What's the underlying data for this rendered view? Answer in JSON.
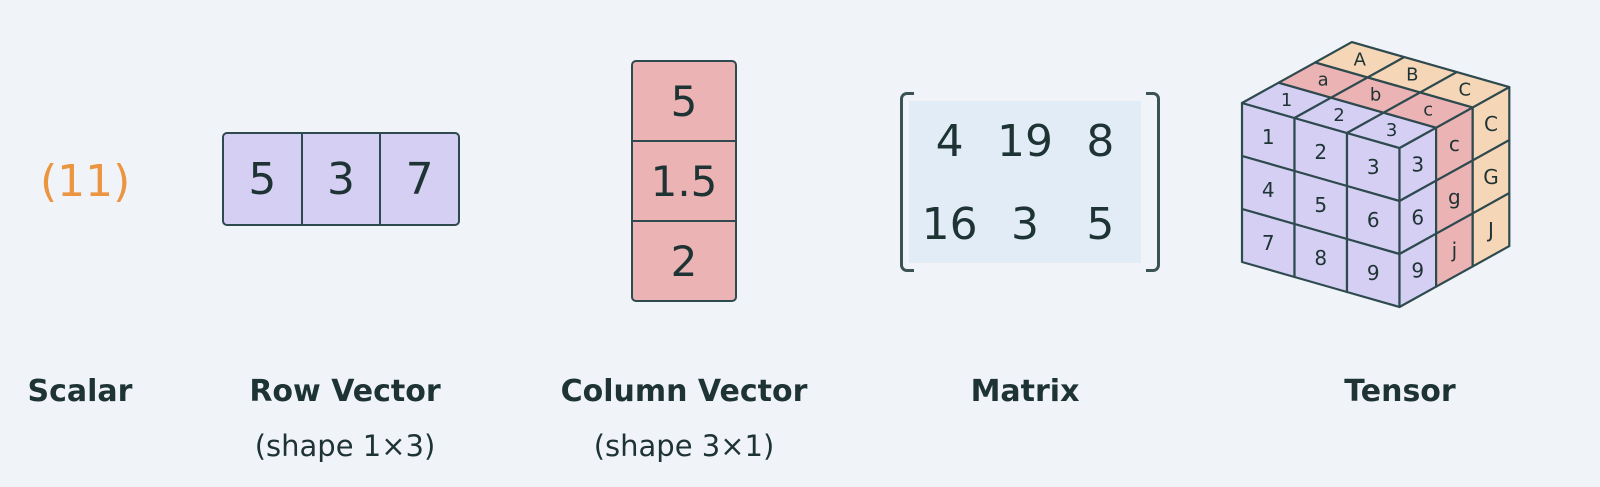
{
  "scalar": {
    "value": "(11)",
    "label": "Scalar"
  },
  "row_vector": {
    "values": [
      "5",
      "3",
      "7"
    ],
    "label": "Row Vector",
    "shape": "(shape 1×3)"
  },
  "column_vector": {
    "values": [
      "5",
      "1.5",
      "2"
    ],
    "label": "Column Vector",
    "shape": "(shape 3×1)"
  },
  "matrix": {
    "rows": [
      [
        "4",
        "19",
        "8"
      ],
      [
        "16",
        "3",
        "5"
      ]
    ],
    "label": "Matrix"
  },
  "tensor": {
    "label": "Tensor",
    "front": [
      "1",
      "2",
      "3",
      "4",
      "5",
      "6",
      "7",
      "8",
      "9"
    ],
    "top": [
      "A",
      "B",
      "C",
      "a",
      "b",
      "c",
      "1",
      "2",
      "3"
    ],
    "side": [
      "c",
      "C",
      "g",
      "G",
      "j",
      "J"
    ],
    "middle_side": [
      "3",
      "6",
      "9"
    ]
  },
  "colors": {
    "scalar": "#ec9540",
    "purple": "#d4cff3",
    "pink": "#ebb3b3",
    "orange": "#f5d6b7",
    "matrix_bg": "#e2ecf7",
    "background": "#f0f3f8",
    "ink": "#1e3334"
  }
}
